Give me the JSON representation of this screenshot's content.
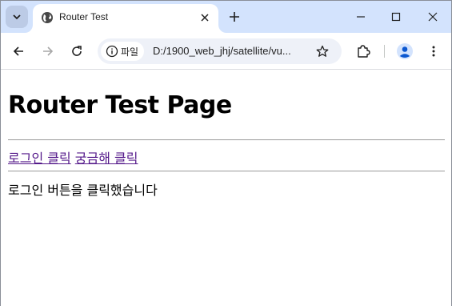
{
  "browser": {
    "tab": {
      "title": "Router Test"
    },
    "omnibox": {
      "site_label": "파일",
      "url": "D:/1900_web_jhj/satellite/vu..."
    }
  },
  "page": {
    "title": "Router Test Page",
    "nav": {
      "login_link": "로그인 클릭",
      "curious_link": "궁금해 클릭"
    },
    "message": "로그인 버튼을 클릭했습니다"
  },
  "colors": {
    "tabstrip": "#d3e3fd",
    "link_visited": "#551a8b",
    "omnibox": "#eef1f8"
  }
}
